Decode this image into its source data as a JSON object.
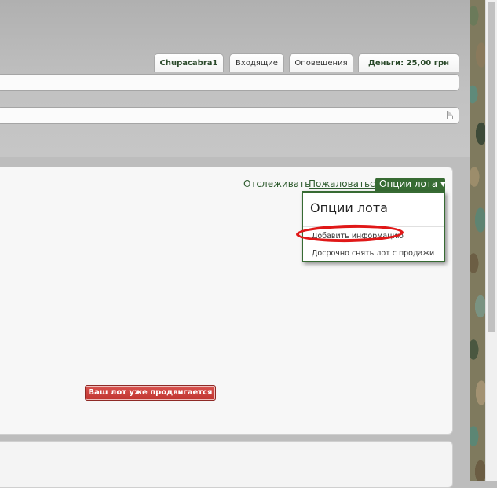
{
  "header": {
    "tabs": [
      {
        "label": "Chupacabra1"
      },
      {
        "label": "Входящие"
      },
      {
        "label": "Оповещения"
      },
      {
        "label": "Деньги: 25,00 грн"
      }
    ]
  },
  "actions": {
    "watch": "Отслеживать",
    "report": "Пожаловаться",
    "options": "Опции лота"
  },
  "dropdown": {
    "title": "Опции лота",
    "items": [
      {
        "label": "Добавить информацию"
      },
      {
        "label": "Досрочно снять лот с продажи"
      }
    ]
  },
  "promo": {
    "label": "Ваш лот уже продвигается"
  },
  "colors": {
    "accent_green": "#376b33",
    "promo_red": "#c03530",
    "highlight_red": "#e01818"
  }
}
